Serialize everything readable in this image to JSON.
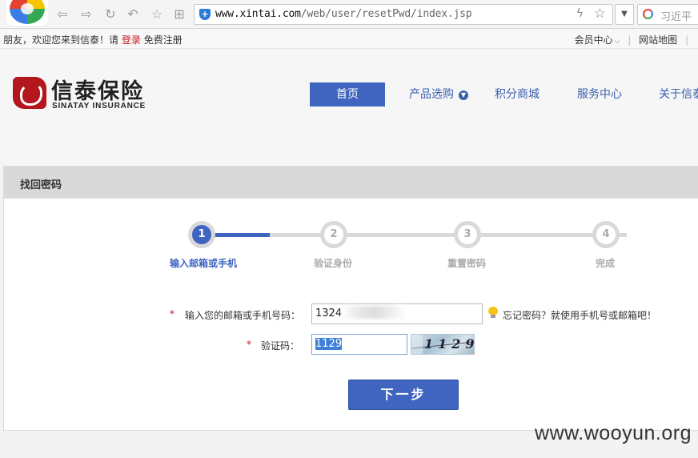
{
  "browser": {
    "url_host": "www.xintai.com",
    "url_path": "/web/user/resetPwd/index.jsp",
    "search_text": "习近平"
  },
  "topbar": {
    "greeting": "朋友，欢迎您来到信泰！请",
    "login": "登录",
    "register": "免费注册",
    "member_center": "会员中心",
    "sitemap": "网站地图"
  },
  "brand": {
    "name_cn": "信泰保险",
    "name_en": "SINATAY INSURANCE"
  },
  "nav": {
    "home": "首页",
    "products": "产品选购",
    "points_mall": "积分商城",
    "service": "服务中心",
    "about": "关于信泰"
  },
  "panel": {
    "title": "找回密码",
    "steps": [
      {
        "number": "1",
        "label": "输入邮箱或手机",
        "active": true
      },
      {
        "number": "2",
        "label": "验证身份",
        "active": false
      },
      {
        "number": "3",
        "label": "重置密码",
        "active": false
      },
      {
        "number": "4",
        "label": "完成",
        "active": false
      }
    ],
    "account_field": {
      "required_mark": "*",
      "label": "输入您的邮箱或手机号码：",
      "value": "1324"
    },
    "hint": "忘记密码？就使用手机号或邮箱吧！",
    "captcha_field": {
      "required_mark": "*",
      "label": "验证码：",
      "value": "1129"
    },
    "captcha_image_text": "1129",
    "next_button": "下一步"
  },
  "watermark": "www.wooyun.org",
  "colors": {
    "primary": "#3f65c0",
    "brand_red": "#b3161c",
    "link_red": "#c8161d"
  }
}
